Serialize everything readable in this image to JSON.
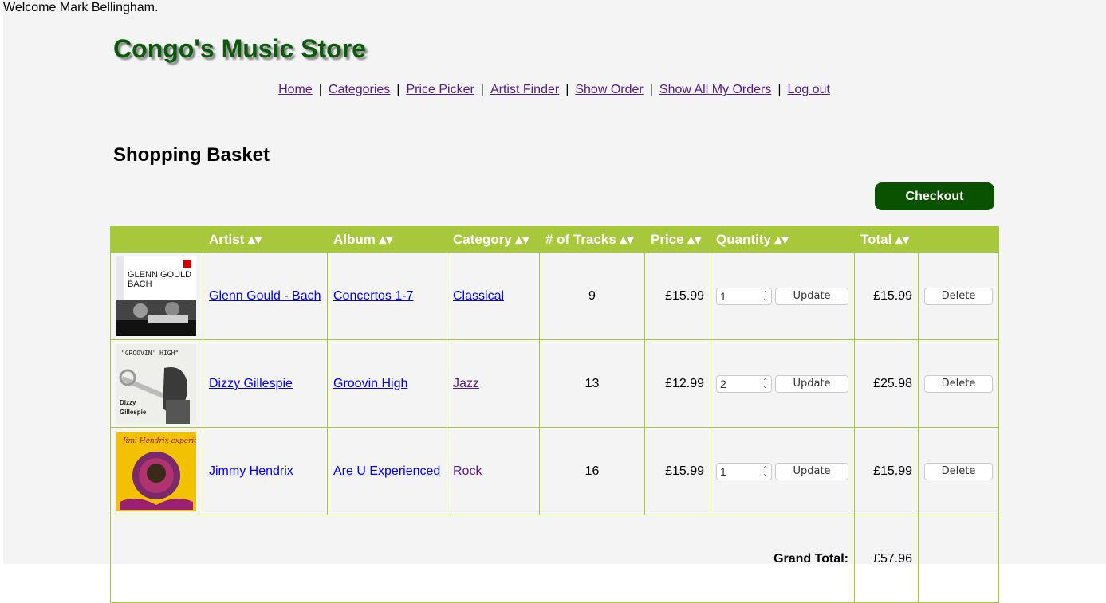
{
  "welcome": "Welcome Mark Bellingham.",
  "site_title": "Congo's Music Store",
  "nav": [
    "Home",
    "Categories",
    "Price Picker",
    "Artist Finder",
    "Show Order",
    "Show All My Orders",
    "Log out"
  ],
  "nav_separator": "|",
  "section_title": "Shopping Basket",
  "checkout_label": "Checkout",
  "columns": [
    "",
    "Artist ▴▾",
    "Album ▴▾",
    "Category ▴▾",
    "# of Tracks ▴▾",
    "Price ▴▾",
    "Quantity ▴▾",
    "Total ▴▾",
    ""
  ],
  "update_label": "Update",
  "delete_label": "Delete",
  "rows": [
    {
      "cover_lines": [
        "GLENN GOULD",
        "BACH"
      ],
      "artist": "Glenn Gould - Bach",
      "album": "Concertos 1-7",
      "category": "Classical",
      "tracks": "9",
      "price": "£15.99",
      "quantity": "1",
      "total": "£15.99"
    },
    {
      "cover_lines": [
        "\"GROOVIN' HIGH\"",
        "Dizzy Gillespie"
      ],
      "artist": "Dizzy Gillespie",
      "album": "Groovin High",
      "category": "Jazz",
      "tracks": "13",
      "price": "£12.99",
      "quantity": "2",
      "total": "£25.98"
    },
    {
      "cover_lines": [
        "Jimi Hendrix experience"
      ],
      "artist": "Jimmy Hendrix",
      "album": "Are U Experienced",
      "category": "Rock",
      "tracks": "16",
      "price": "£15.99",
      "quantity": "1",
      "total": "£15.99"
    }
  ],
  "grand_total_label": "Grand Total:",
  "grand_total": "£57.96",
  "colors": {
    "header": "#a8c83c",
    "title": "#0b5a0b",
    "checkout": "#0b5200"
  }
}
